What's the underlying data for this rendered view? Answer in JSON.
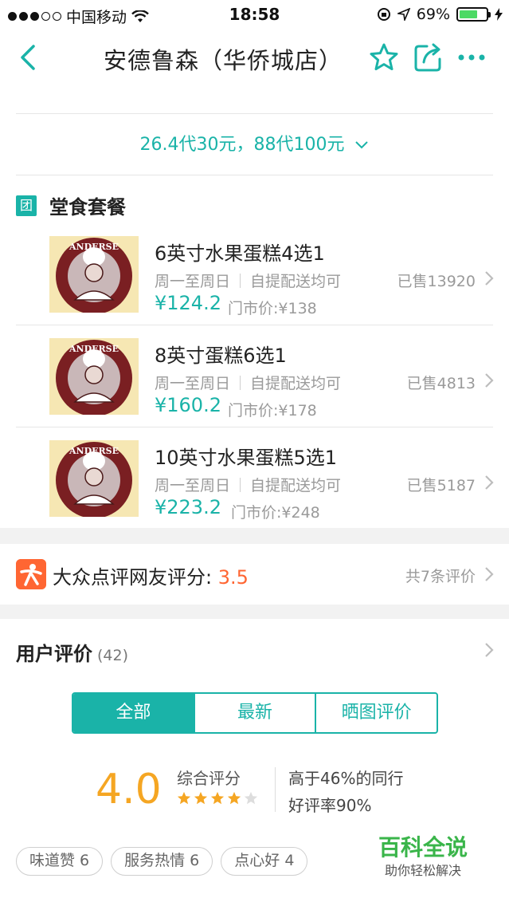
{
  "status_bar": {
    "carrier": "中国移动",
    "time": "18:58",
    "battery_pct": "69%",
    "battery_level": 0.69
  },
  "nav": {
    "title": "安德鲁森（华侨城店）"
  },
  "voucher": {
    "summary": "26.4代30元，88代100元"
  },
  "group_section": {
    "badge": "团",
    "title": "堂食套餐",
    "deals": [
      {
        "name": "6英寸水果蛋糕4选1",
        "days": "周一至周日",
        "delivery": "自提配送均可",
        "price": "¥124.2",
        "orig_price": "门市价:¥138",
        "sold": "已售13920"
      },
      {
        "name": "8英寸蛋糕6选1",
        "days": "周一至周日",
        "delivery": "自提配送均可",
        "price": "¥160.2",
        "orig_price": "门市价:¥178",
        "sold": "已售4813"
      },
      {
        "name": "10英寸水果蛋糕5选1",
        "days": "周一至周日",
        "delivery": "自提配送均可",
        "price": "¥223.2",
        "orig_price": "门市价:¥248",
        "sold": "已售5187"
      }
    ],
    "logo_text": "ANDERSE"
  },
  "dianping": {
    "label": "大众点评网友评分: ",
    "score": "3.5",
    "count": "共7条评价"
  },
  "reviews": {
    "title": "用户评价",
    "count": "(42)",
    "tabs": [
      "全部",
      "最新",
      "晒图评价"
    ],
    "active_tab": 0,
    "overall_score": "4.0",
    "overall_label": "综合评分",
    "stars_filled": 4,
    "stars_total": 5,
    "peer_text": "高于46%的同行",
    "good_rate": "好评率90%",
    "tags": [
      "味道赞 6",
      "服务热情 6",
      "点心好 4"
    ]
  },
  "watermark": {
    "title": "百科全说",
    "subtitle": "助你轻松解决"
  },
  "colors": {
    "accent": "#1ab3a8",
    "orange": "#ff6633",
    "star": "#f5a623"
  }
}
